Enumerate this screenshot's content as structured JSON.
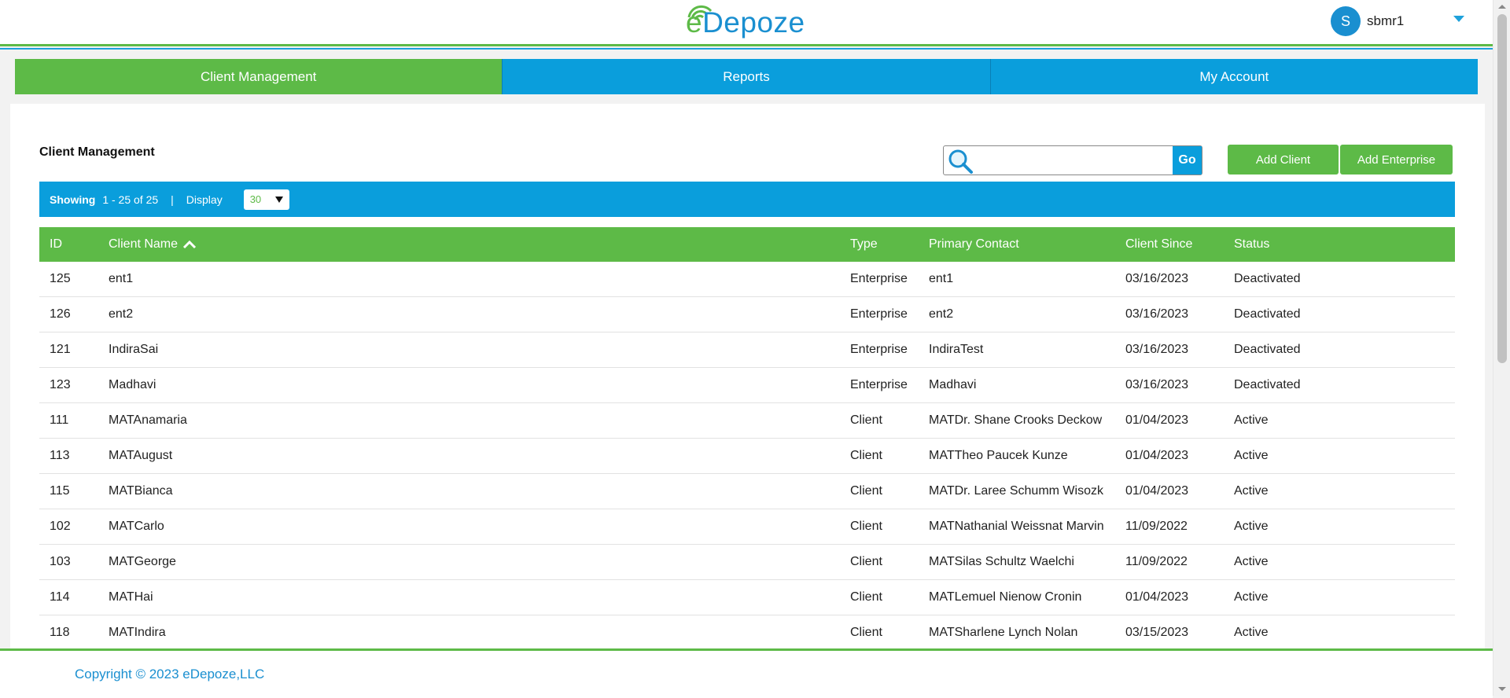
{
  "header": {
    "logo_e": "e",
    "logo_rest": "Depoze",
    "user_initial": "S",
    "username": "sbmr1"
  },
  "nav": {
    "tabs": [
      {
        "label": "Client Management",
        "active": true
      },
      {
        "label": "Reports",
        "active": false
      },
      {
        "label": "My Account",
        "active": false
      }
    ]
  },
  "main": {
    "title": "Client Management",
    "search": {
      "value": "",
      "placeholder": "",
      "go_label": "Go"
    },
    "buttons": {
      "add_client": "Add Client",
      "add_enterprise": "Add Enterprise"
    },
    "pager": {
      "showing_label": "Showing",
      "range": "1 - 25 of 25",
      "separator": "|",
      "display_label": "Display",
      "display_value": "30"
    },
    "table": {
      "columns": {
        "id": "ID",
        "name": "Client Name",
        "type": "Type",
        "contact": "Primary Contact",
        "since": "Client Since",
        "status": "Status"
      },
      "sort_column": "Client Name",
      "rows": [
        {
          "id": "125",
          "name": "ent1",
          "type": "Enterprise",
          "contact": "ent1",
          "since": "03/16/2023",
          "status": "Deactivated"
        },
        {
          "id": "126",
          "name": "ent2",
          "type": "Enterprise",
          "contact": "ent2",
          "since": "03/16/2023",
          "status": "Deactivated"
        },
        {
          "id": "121",
          "name": "IndiraSai",
          "type": "Enterprise",
          "contact": "IndiraTest",
          "since": "03/16/2023",
          "status": "Deactivated"
        },
        {
          "id": "123",
          "name": "Madhavi",
          "type": "Enterprise",
          "contact": "Madhavi",
          "since": "03/16/2023",
          "status": "Deactivated"
        },
        {
          "id": "111",
          "name": "MATAnamaria",
          "type": "Client",
          "contact": "MATDr. Shane Crooks Deckow",
          "since": "01/04/2023",
          "status": "Active"
        },
        {
          "id": "113",
          "name": "MATAugust",
          "type": "Client",
          "contact": "MATTheo Paucek Kunze",
          "since": "01/04/2023",
          "status": "Active"
        },
        {
          "id": "115",
          "name": "MATBianca",
          "type": "Client",
          "contact": "MATDr. Laree Schumm Wisozk",
          "since": "01/04/2023",
          "status": "Active"
        },
        {
          "id": "102",
          "name": "MATCarlo",
          "type": "Client",
          "contact": "MATNathanial Weissnat Marvin",
          "since": "11/09/2022",
          "status": "Active"
        },
        {
          "id": "103",
          "name": "MATGeorge",
          "type": "Client",
          "contact": "MATSilas Schultz Waelchi",
          "since": "11/09/2022",
          "status": "Active"
        },
        {
          "id": "114",
          "name": "MATHai",
          "type": "Client",
          "contact": "MATLemuel Nienow Cronin",
          "since": "01/04/2023",
          "status": "Active"
        },
        {
          "id": "118",
          "name": "MATIndira",
          "type": "Client",
          "contact": "MATSharlene Lynch Nolan",
          "since": "03/15/2023",
          "status": "Active"
        }
      ]
    }
  },
  "footer": {
    "copyright": "Copyright © 2023 eDepoze,LLC"
  },
  "colors": {
    "green": "#5dba47",
    "blue": "#0a9edc",
    "deactivated": "#b52020",
    "active": "#3aa534"
  }
}
